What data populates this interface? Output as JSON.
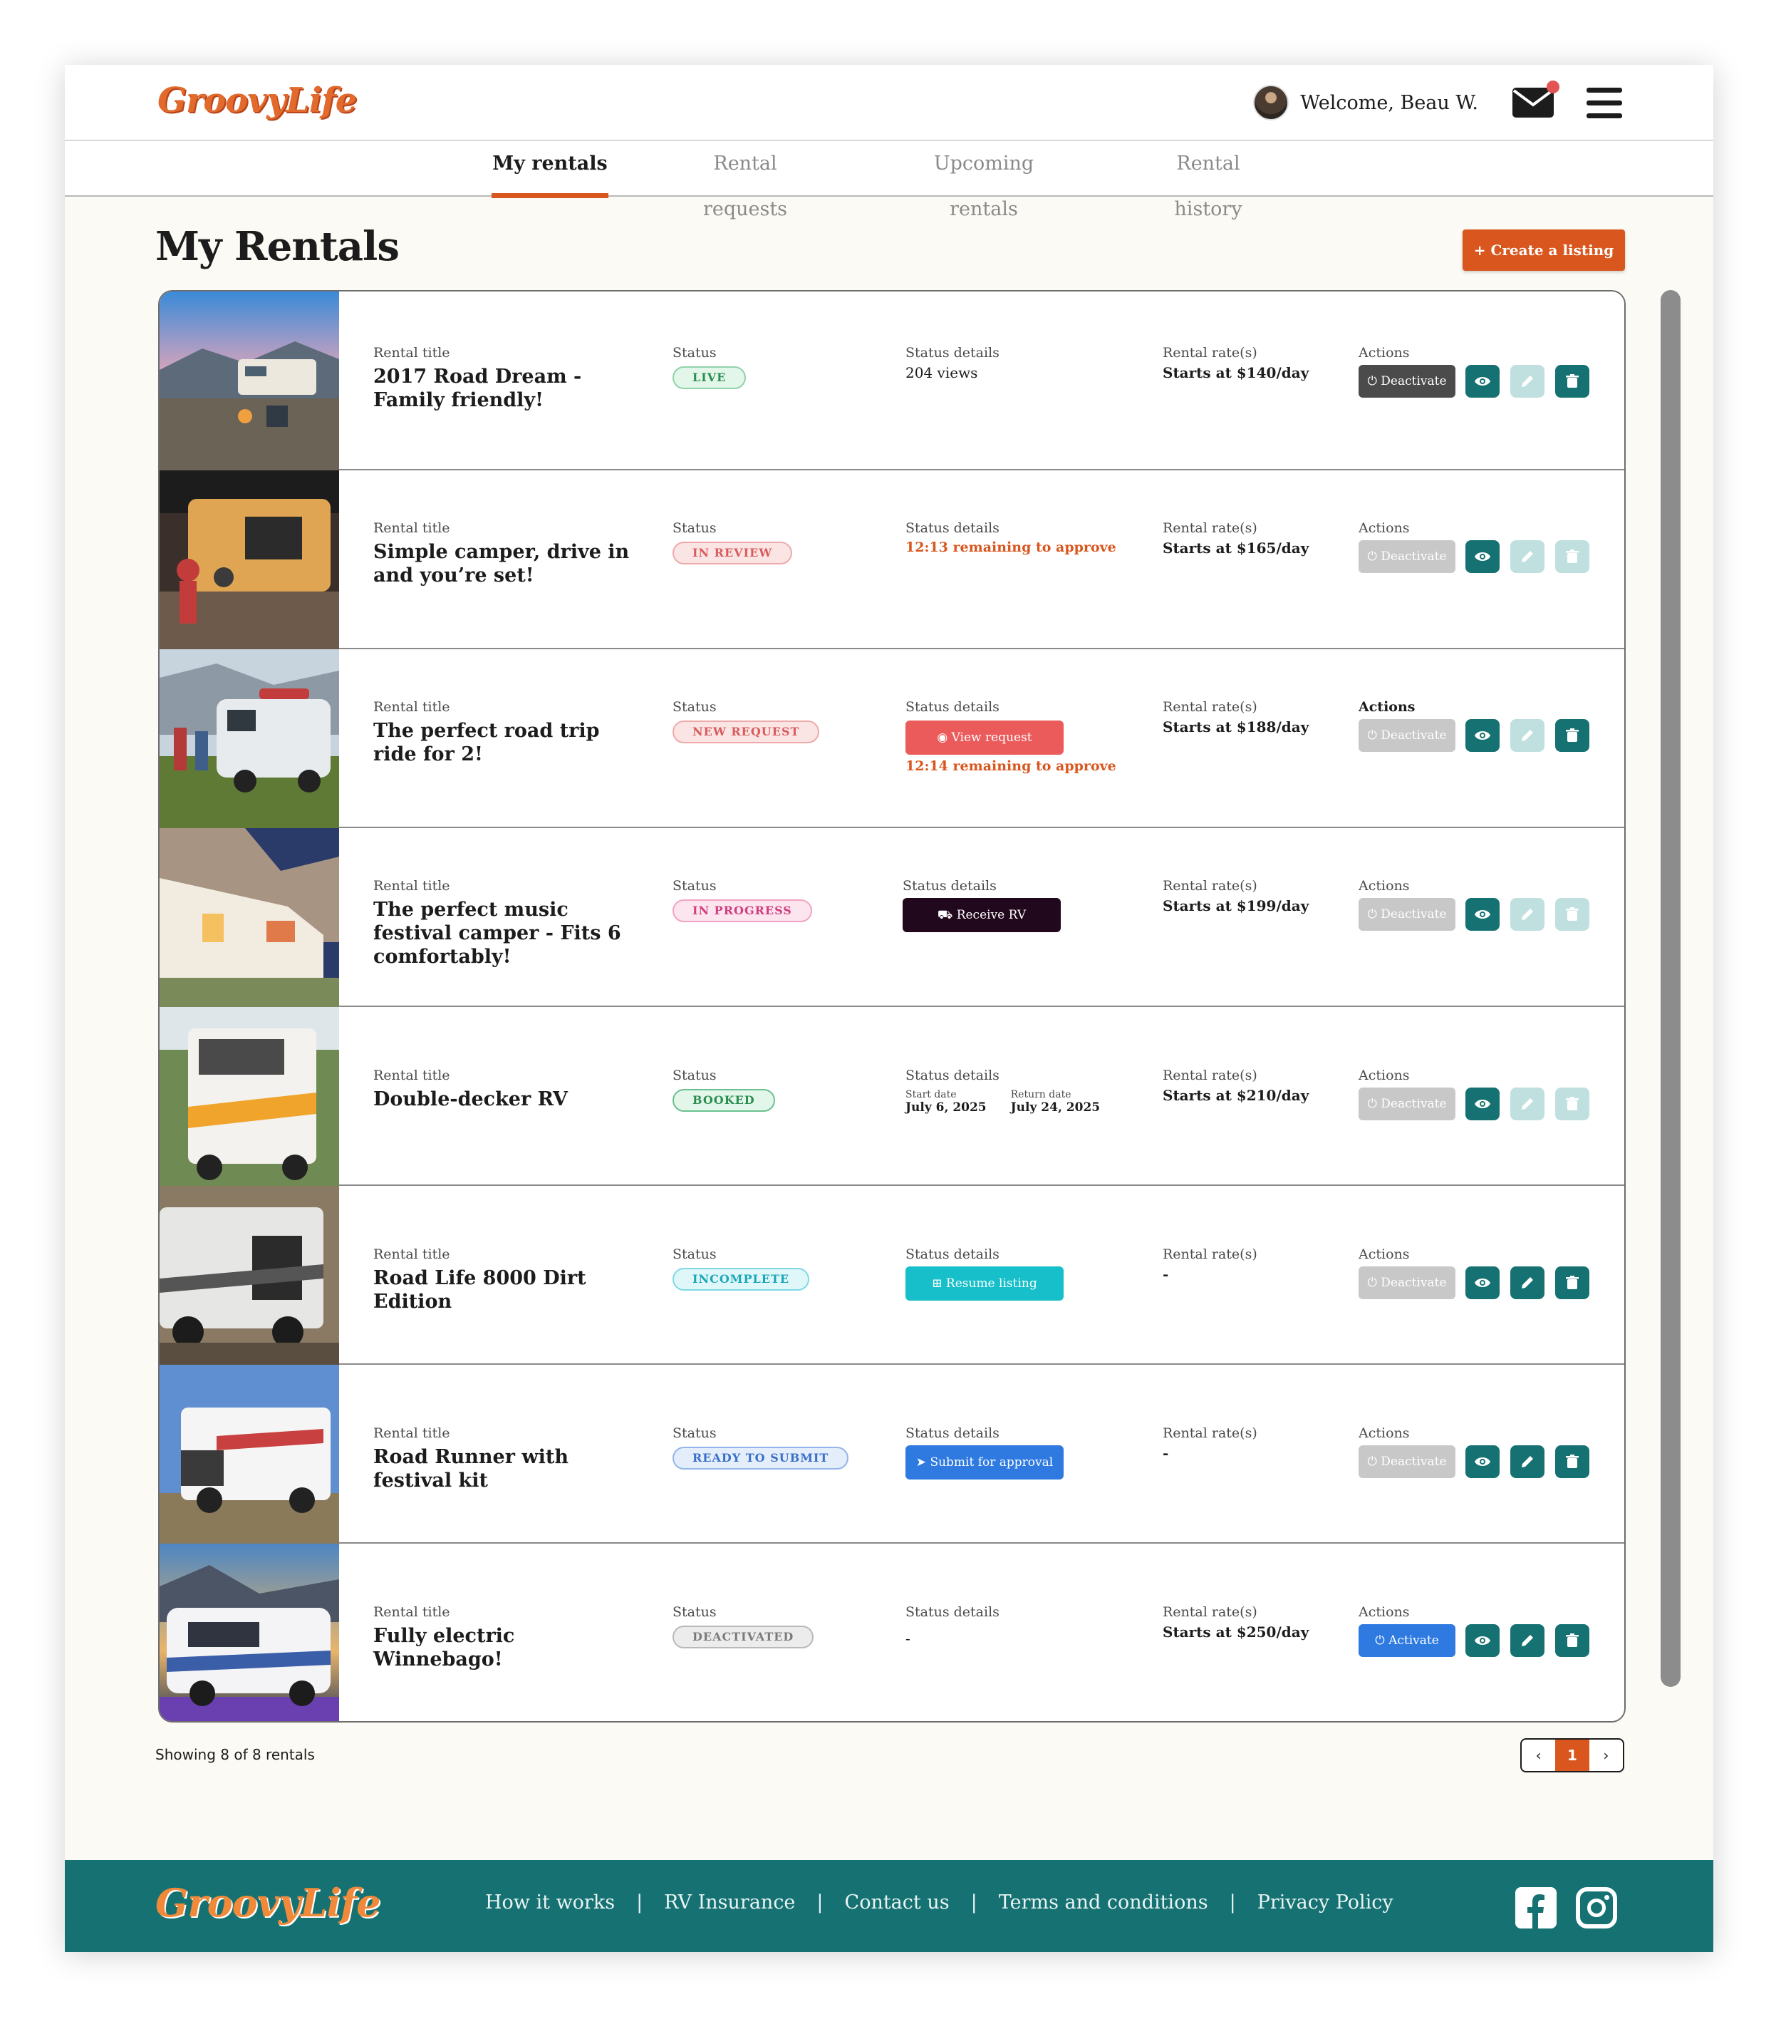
{
  "brand": {
    "name": "GroovyLife"
  },
  "header": {
    "welcome": "Welcome, Beau W."
  },
  "tabs": [
    {
      "label": "My rentals",
      "active": true
    },
    {
      "label": "Rental requests",
      "active": false
    },
    {
      "label": "Upcoming rentals",
      "active": false
    },
    {
      "label": "Rental history",
      "active": false
    }
  ],
  "page": {
    "title": "My Rentals",
    "create_label": "+ Create a listing"
  },
  "columns": {
    "title": "Rental title",
    "status": "Status",
    "details": "Status details",
    "rate": "Rental rate(s)",
    "actions": "Actions"
  },
  "rentals": [
    {
      "title": "2017 Road Dream - Family friendly!",
      "status": "LIVE",
      "details": "204 views",
      "rate": "Starts at $140/day",
      "toggle": "Deactivate"
    },
    {
      "title": "Simple camper, drive in and you’re set!",
      "status": "IN REVIEW",
      "details": "12:13 remaining to approve",
      "rate": "Starts at $165/day",
      "toggle": "Deactivate"
    },
    {
      "title": "The perfect road trip ride for 2!",
      "status": "NEW REQUEST",
      "details_button": "View request",
      "details": "12:14 remaining to approve",
      "rate": "Starts at $188/day",
      "toggle": "Deactivate"
    },
    {
      "title": "The perfect music festival camper - Fits 6 comfortably!",
      "status": "IN PROGRESS",
      "details_button": "Receive RV",
      "rate": "Starts at $199/day",
      "toggle": "Deactivate"
    },
    {
      "title": "Double-decker RV",
      "status": "BOOKED",
      "start_label": "Start date",
      "start": "July 6, 2025",
      "return_label": "Return date",
      "return": "July 24, 2025",
      "rate": "Starts at $210/day",
      "toggle": "Deactivate"
    },
    {
      "title": "Road Life 8000 Dirt Edition",
      "status": "INCOMPLETE",
      "details_button": "Resume listing",
      "rate": "-",
      "toggle": "Deactivate"
    },
    {
      "title": "Road Runner with festival kit",
      "status": "READY TO SUBMIT",
      "details_button": "Submit for approval",
      "rate": "-",
      "toggle": "Deactivate"
    },
    {
      "title": "Fully electric Winnebago!",
      "status": "DEACTIVATED",
      "details": "-",
      "rate": "Starts at $250/day",
      "toggle": "Activate"
    }
  ],
  "pagination": {
    "summary": "Showing 8 of 8 rentals",
    "current": "1"
  },
  "footer": {
    "links": [
      "How it works",
      "RV Insurance",
      "Contact us",
      "Terms and conditions",
      "Privacy Policy"
    ],
    "separator": "|"
  },
  "colors": {
    "brand_orange": "#d9571e",
    "teal": "#167272"
  }
}
